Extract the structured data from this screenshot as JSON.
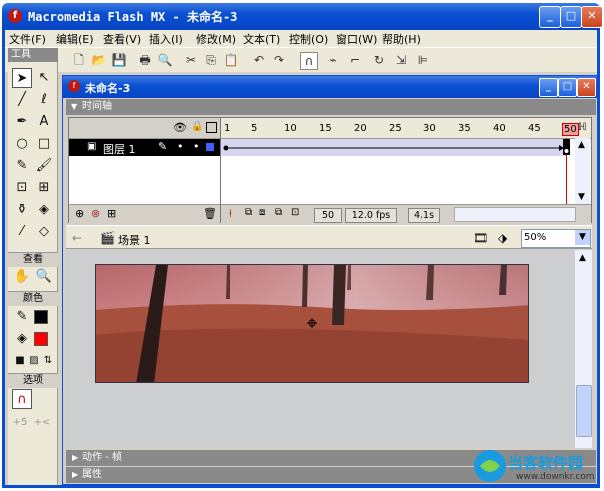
{
  "window": {
    "title": "Macromedia Flash MX - 未命名-3",
    "app_icon": "flash-icon"
  },
  "menu": [
    "文件(F)",
    "编辑(E)",
    "查看(V)",
    "插入(I)",
    "修改(M)",
    "文本(T)",
    "控制(O)",
    "窗口(W)",
    "帮助(H)"
  ],
  "toolbar_icons": [
    "new-icon",
    "open-icon",
    "save-icon",
    "print-icon",
    "print-preview-icon",
    "cut-icon",
    "copy-icon",
    "paste-icon",
    "undo-icon",
    "redo-icon",
    "snap-magnet-icon",
    "smooth-icon",
    "straighten-icon",
    "rotate-icon",
    "scale-icon",
    "align-icon"
  ],
  "tools_panel": {
    "title": "工具",
    "view_label": "查看",
    "colors_label": "颜色",
    "options_label": "选项",
    "stroke_color": "#000000",
    "fill_color": "#ff0000"
  },
  "document": {
    "title": "未命名-3",
    "timeline_label": "时间轴",
    "layer_name": "图层 1",
    "ruler_ticks": [
      "1",
      "5",
      "10",
      "15",
      "20",
      "25",
      "30",
      "35",
      "40",
      "45",
      "50"
    ],
    "current_frame": "50",
    "frame_rate": "12.0 fps",
    "elapsed_time": "4.1s",
    "scene_label": "场景 1",
    "zoom": "50%"
  },
  "panels": {
    "actions": "动作 - 帧",
    "properties": "属性"
  },
  "watermark": {
    "brand": "当客软件园",
    "url": "www.downkr.com"
  }
}
